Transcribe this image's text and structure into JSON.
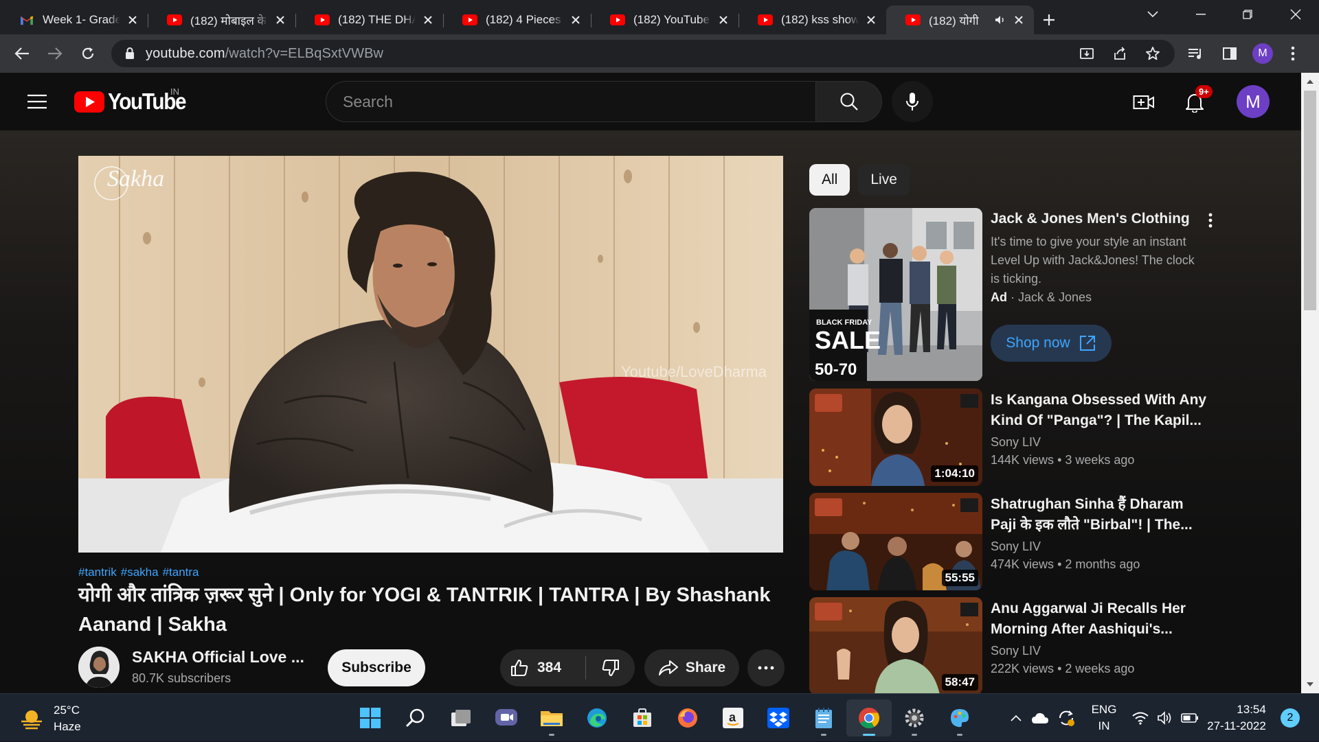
{
  "browser": {
    "tabs": [
      {
        "title": "Week 1- Grade",
        "icon": "gmail-icon",
        "active": false
      },
      {
        "title": "(182) मोबाइल के",
        "icon": "youtube-icon",
        "active": false
      },
      {
        "title": "(182) THE DHA",
        "icon": "youtube-icon",
        "active": false
      },
      {
        "title": "(182) 4 Pieces I",
        "icon": "youtube-icon",
        "active": false
      },
      {
        "title": "(182) YouTube",
        "icon": "youtube-icon",
        "active": false
      },
      {
        "title": "(182) kss show",
        "icon": "youtube-icon",
        "active": false
      },
      {
        "title": "(182) योगी",
        "icon": "youtube-icon",
        "active": true,
        "audio": true
      }
    ],
    "url_host": "youtube.com",
    "url_path": "/watch?v=ELBqSxtVWBw",
    "profile_initial": "M"
  },
  "youtube": {
    "logo_text": "YouTube",
    "country_code": "IN",
    "search_placeholder": "Search",
    "notification_badge": "9+",
    "avatar_initial": "M"
  },
  "video": {
    "hashtags": [
      "#tantrik",
      "#sakha",
      "#tantra"
    ],
    "title": "योगी और तांत्रिक ज़रूर सुने | Only for YOGI & TANTRIK | TANTRA | By Shashank Aanand | Sakha",
    "watermark_logo": "Sakha",
    "watermark_text": "Youtube/LoveDharma",
    "channel_name": "SAKHA Official Love ...",
    "subscribers": "80.7K subscribers",
    "subscribe_label": "Subscribe",
    "likes": "384",
    "share_label": "Share"
  },
  "sidebar": {
    "chips": [
      "All",
      "Live"
    ],
    "ad": {
      "title": "Jack & Jones Men's Clothing",
      "description": "It's time to give your style an instant Level Up with Jack&Jones! The clock is ticking.",
      "ad_label": "Ad",
      "advertiser": "Jack & Jones",
      "cta": "Shop now",
      "thumb_sale_line1": "BLACK FRIDAY",
      "thumb_sale_line2": "SALE",
      "thumb_sale_line3": "50-70"
    },
    "recommendations": [
      {
        "title": "Is Kangana Obsessed With Any Kind Of \"Panga\"? | The Kapil...",
        "channel": "Sony LIV",
        "views": "144K views",
        "age": "3 weeks ago",
        "duration": "1:04:10"
      },
      {
        "title": "Shatrughan Sinha हैं Dharam Paji के इक लौते \"Birbal\"! | The...",
        "channel": "Sony LIV",
        "views": "474K views",
        "age": "2 months ago",
        "duration": "55:55"
      },
      {
        "title": "Anu Aggarwal Ji Recalls Her Morning After Aashiqui's...",
        "channel": "Sony LIV",
        "views": "222K views",
        "age": "2 weeks ago",
        "duration": "58:47"
      }
    ]
  },
  "taskbar": {
    "weather_temp": "25°C",
    "weather_desc": "Haze",
    "lang_line1": "ENG",
    "lang_line2": "IN",
    "time": "13:54",
    "date": "27-11-2022",
    "notification_count": "2"
  },
  "colors": {
    "youtube_red": "#ff0000",
    "link_blue": "#3ea6ff",
    "background": "#0f0f0f",
    "chrome_dark": "#202124"
  }
}
